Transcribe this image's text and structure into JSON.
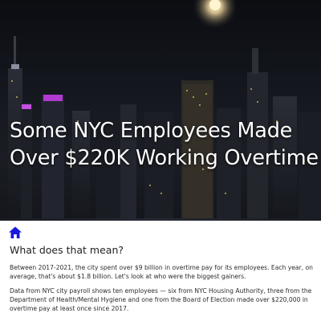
{
  "hero": {
    "title": "Some NYC Employees Made Over $220K Working Overtime"
  },
  "nav": {
    "home_icon": "home-icon",
    "home_color": "#1a1adb"
  },
  "article": {
    "heading": "What does that mean?",
    "paragraphs": [
      "Between 2017-2021, the city spent over $9 billion in overtime pay for its employees. Each year, on average, that's about $1.8 billion. Let's look at who were the biggest gainers.",
      "Data from NYC city payroll shows ten employees — six from NYC Housing Authority, three from the Department of Health/Mental Hygiene and one from the Board of Election made over $220,000 in overtime pay at least once since 2017."
    ]
  }
}
